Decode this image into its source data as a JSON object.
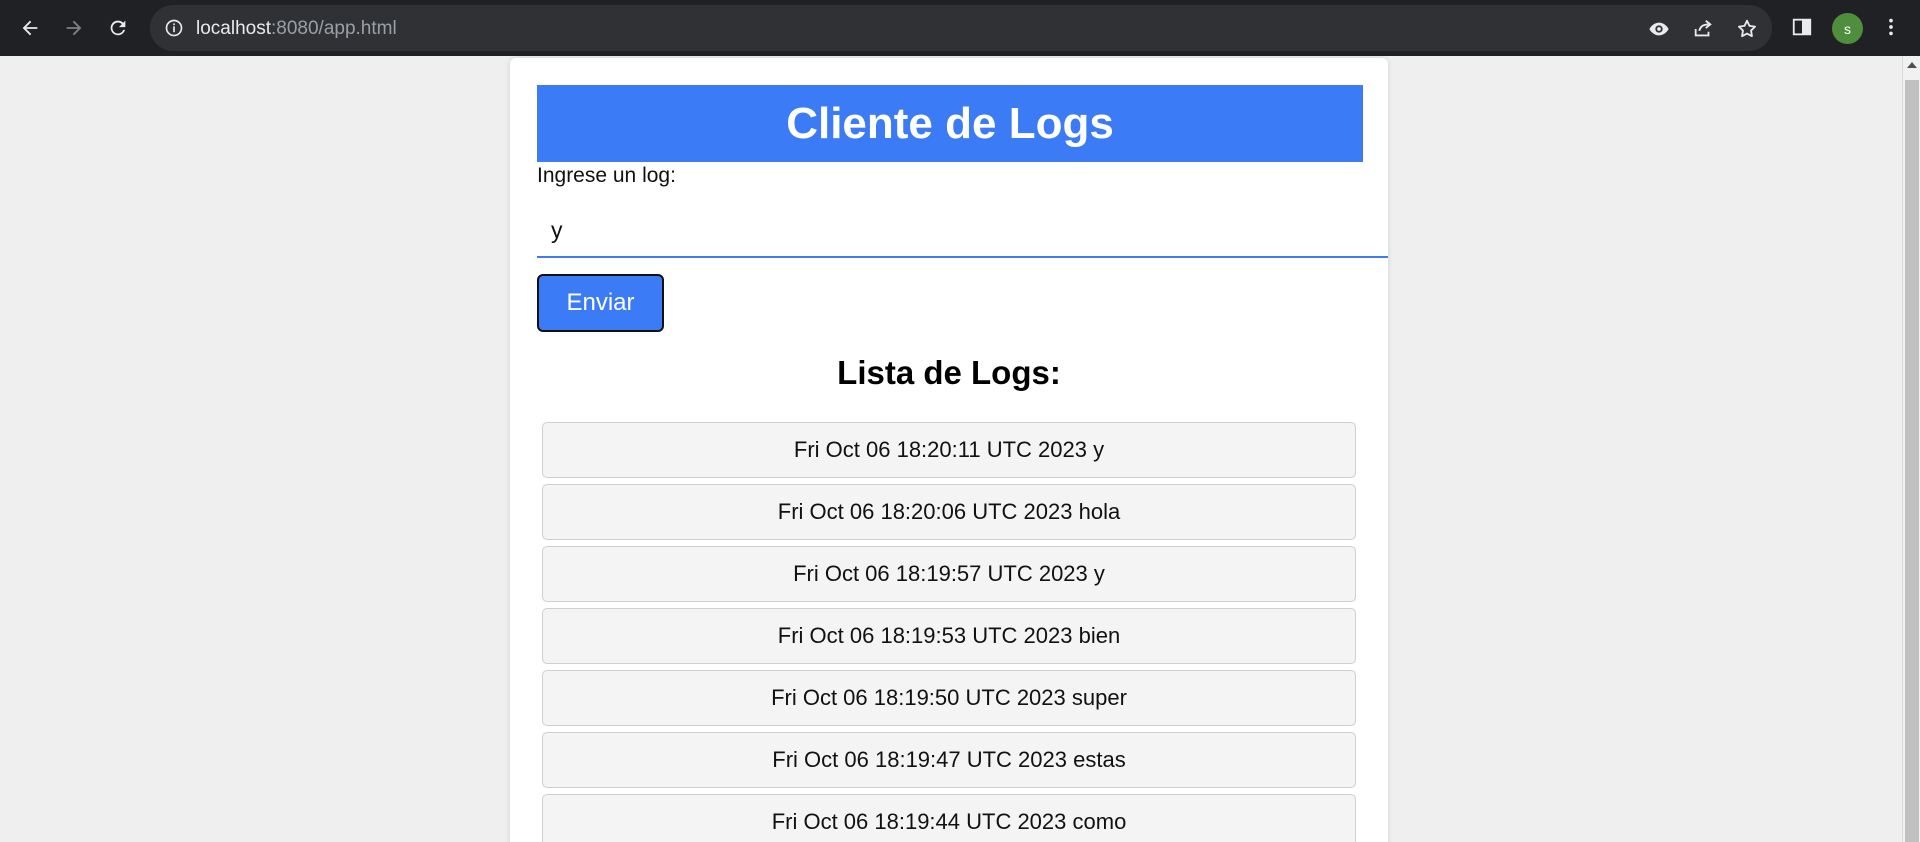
{
  "browser": {
    "url_host": "localhost",
    "url_rest": ":8080/app.html",
    "profile_initial": "s",
    "accent": "#3b7bf5"
  },
  "page": {
    "header_title": "Cliente de Logs",
    "input_label": "Ingrese un log:",
    "input_value": "y",
    "send_label": "Enviar",
    "list_title": "Lista de Logs:"
  },
  "logs": [
    "Fri Oct 06 18:20:11 UTC 2023 y",
    "Fri Oct 06 18:20:06 UTC 2023 hola",
    "Fri Oct 06 18:19:57 UTC 2023 y",
    "Fri Oct 06 18:19:53 UTC 2023 bien",
    "Fri Oct 06 18:19:50 UTC 2023 super",
    "Fri Oct 06 18:19:47 UTC 2023 estas",
    "Fri Oct 06 18:19:44 UTC 2023 como"
  ]
}
